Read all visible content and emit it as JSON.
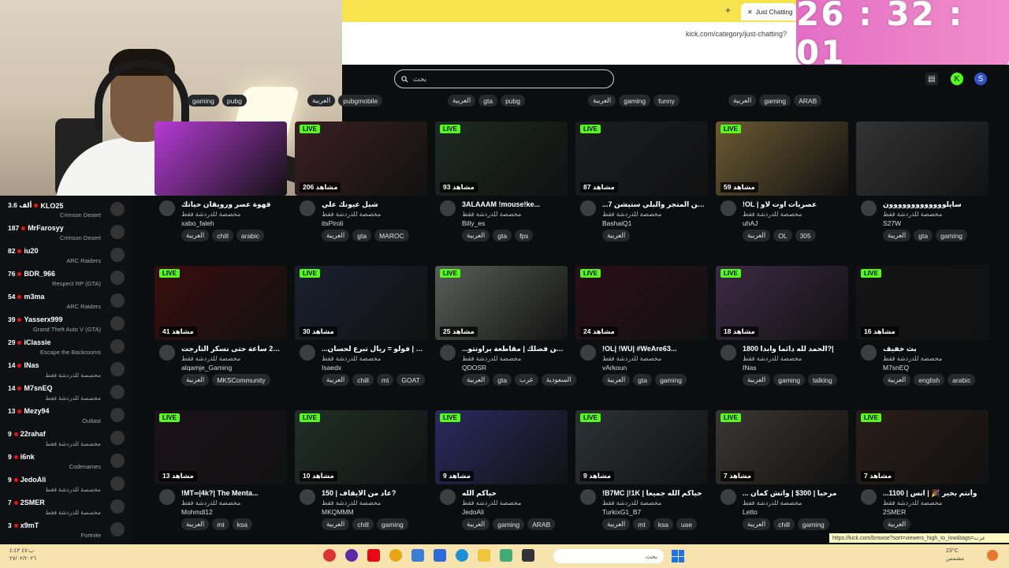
{
  "timer": "26 : 32 : 01",
  "browser": {
    "tab_label": "Just Chatting",
    "new_tab": "+",
    "tab_close": "✕",
    "url": "kick.com/category/just-chatting?",
    "status_url": "https://kick.com/browse?sort=viewers_high_to_low&tags=عرب"
  },
  "header": {
    "search_placeholder": "بحث"
  },
  "top_tag_rows": [
    [
      "gaming",
      "pubg"
    ],
    [
      "العربية",
      "pubgmobile"
    ],
    [
      "العربية",
      "gta",
      "pubg"
    ],
    [
      "العربية",
      "gaming",
      "funny"
    ],
    [
      "العربية",
      "gaming",
      "ARAB"
    ]
  ],
  "sidebar": [
    {
      "viewers": "3.6 ألف",
      "name": "KLO25",
      "category": "Crimson Desert"
    },
    {
      "viewers": "187",
      "name": "MrFarosyy",
      "category": "Crimson Desert"
    },
    {
      "viewers": "82",
      "name": "iu20",
      "category": "ARC Raiders"
    },
    {
      "viewers": "76",
      "name": "BDR_966",
      "category": "Respect RP (GTA)"
    },
    {
      "viewers": "54",
      "name": "m3ma",
      "category": "ARC Raiders"
    },
    {
      "viewers": "39",
      "name": "Yasserx999",
      "category": "Grand Theft Auto V (GTA)"
    },
    {
      "viewers": "29",
      "name": "iClassie",
      "category": "Escape the Backrooms"
    },
    {
      "viewers": "14",
      "name": "INas",
      "category": "مخصصة للدردشة فقط"
    },
    {
      "viewers": "14",
      "name": "M7snEQ",
      "category": "مخصصة للدردشة فقط"
    },
    {
      "viewers": "13",
      "name": "Mezy94",
      "category": "Outlast"
    },
    {
      "viewers": "9",
      "name": "22rahaf",
      "category": "مخصصة للدردشة فقط"
    },
    {
      "viewers": "9",
      "name": "i6nk",
      "category": "Codenames"
    },
    {
      "viewers": "9",
      "name": "JedoAli",
      "category": "مخصصة للدردشة فقط"
    },
    {
      "viewers": "7",
      "name": "2SMER",
      "category": "مخصصة للدردشة فقط"
    },
    {
      "viewers": "3",
      "name": "x9mT",
      "category": "Fortnite"
    }
  ],
  "streams": [
    {
      "live": "",
      "viewers": "",
      "title": "قهوة عصر ورويقان حياتك",
      "category": "مخصصة للدردشة فقط",
      "name": "xabo_faleh",
      "tags": [
        "العربية",
        "chill",
        "arabic"
      ],
      "color": "#b73bd6"
    },
    {
      "live": "LIVE",
      "viewers": "206 مشاهد",
      "title": "شيل عيونك علي",
      "category": "مخصصة للدردشة فقط",
      "name": "itsPiroli",
      "tags": [
        "العربية",
        "gta",
        "MAROC"
      ],
      "color": "#3a1f22"
    },
    {
      "live": "LIVE",
      "viewers": "93 مشاهد",
      "title": "3ALAAAM !mouse!ke...",
      "category": "مخصصة للدردشة فقط",
      "name": "Billy_es",
      "tags": [
        "العربية",
        "gta",
        "fps"
      ],
      "color": "#1c2a22"
    },
    {
      "live": "LIVE",
      "viewers": "87 مشاهد",
      "title": "...ن عن المتجر والبلي ستيشن 7",
      "category": "مخصصة للدردشة فقط",
      "name": "BashaiQ1",
      "tags": [
        "العربية"
      ],
      "color": "#1b1d22"
    },
    {
      "live": "LIVE",
      "viewers": "59 مشاهد",
      "title": "!OL | عصريات اوت لاو",
      "category": "مخصصة للدردشة فقط",
      "name": "uhAJ",
      "tags": [
        "العربية",
        "OL",
        "305"
      ],
      "color": "#6b5a32"
    },
    {
      "live": "",
      "viewers": "",
      "title": "سايلووووووووووووون",
      "category": "مخصصة للدردشة فقط",
      "name": "S27W",
      "tags": [
        "العربية",
        "gta",
        "gaming"
      ],
      "color": "#333"
    },
    {
      "live": "LIVE",
      "viewers": "41 مشاهد",
      "title": "بث 24 ساعة حتى نسكر التارجت",
      "category": "مخصصة للدردشة فقط",
      "name": "alqamje_Gaming",
      "tags": [
        "العربية",
        "MKSCommunity"
      ],
      "color": "#3a0d0d"
    },
    {
      "live": "LIVE",
      "viewers": "30 مشاهد",
      "title": "...نس | فولو = ريال تبرع لحسان",
      "category": "مخصصة للدردشة فقط",
      "name": "Isaedx",
      "tags": [
        "العربية",
        "chill",
        "mt",
        "GOAT"
      ],
      "color": "#1a2030"
    },
    {
      "live": "LIVE",
      "viewers": "25 مشاهد",
      "title": "...ويالله من فضلك | مقاطعة براونتو",
      "category": "مخصصة للدردشة فقط",
      "name": "QDOSR",
      "tags": [
        "العربية",
        "gta",
        "عرب",
        "السعودية"
      ],
      "color": "#5a5e58"
    },
    {
      "live": "LIVE",
      "viewers": "24 مشاهد",
      "title": "!OL| !WU| #WeAre63...",
      "category": "مخصصة للدردشة فقط",
      "name": "vArkoun",
      "tags": [
        "العربية",
        "gta",
        "gaming"
      ],
      "color": "#2a0e18"
    },
    {
      "live": "LIVE",
      "viewers": "18 مشاهد",
      "title": "الحمد لله دائما وابدا 1800?|",
      "category": "مخصصة للدردشة فقط",
      "name": "INas",
      "tags": [
        "العربية",
        "gaming",
        "talking"
      ],
      "color": "#3d2a45"
    },
    {
      "live": "LIVE",
      "viewers": "16 مشاهد",
      "title": "بث خفيف",
      "category": "مخصصة للدردشة فقط",
      "name": "M7snEQ",
      "tags": [
        "العربية",
        "english",
        "arabic"
      ],
      "color": "#141414"
    },
    {
      "live": "LIVE",
      "viewers": "13 مشاهد",
      "title": "!MT∞|4k?| The Menta...",
      "category": "مخصصة للدردشة فقط",
      "name": "Mohmdl12",
      "tags": [
        "العربية",
        "mt",
        "ksa"
      ],
      "color": "#1a1218"
    },
    {
      "live": "LIVE",
      "viewers": "10 مشاهد",
      "title": "عاد من الايقاف | 150?",
      "category": "مخصصة للدردشة فقط",
      "name": "MKQMMM",
      "tags": [
        "العربية",
        "chill",
        "gaming"
      ],
      "color": "#203028"
    },
    {
      "live": "LIVE",
      "viewers": "9 مشاهد",
      "title": "حياكم الله",
      "category": "مخصصة للدردشة فقط",
      "name": "JedoAli",
      "tags": [
        "العربية",
        "gaming",
        "ARAB"
      ],
      "color": "#2a2a60"
    },
    {
      "live": "LIVE",
      "viewers": "9 مشاهد",
      "title": "!B7MC |!1K | حياكم الله جميعا",
      "category": "مخصصة للدردشة فقط",
      "name": "TurkixG1_B7",
      "tags": [
        "العربية",
        "mt",
        "ksa",
        "uae"
      ],
      "color": "#2b3236"
    },
    {
      "live": "LIVE",
      "viewers": "7 مشاهد",
      "title": "... مرحبا | 300$ | واتش كمان",
      "category": "مخصصة للدردشة فقط",
      "name": "Letto",
      "tags": [
        "العربية",
        "chill",
        "gaming"
      ],
      "color": "#3a3634"
    },
    {
      "live": "LIVE",
      "viewers": "7 مشاهد",
      "title": "...وأنتم بخير 🎉 | انس | 1100",
      "category": "مخصصة للدردشة فقط",
      "name": "2SMER",
      "tags": [
        "العربية"
      ],
      "color": "#2a1e18"
    }
  ],
  "taskbar": {
    "search_text": "بحث",
    "left_text_1": "ب:٤٧ ٤:٤٣",
    "left_text_2": "٢٧/٠٢/٢٠٢٦",
    "right_text_1": "23°C",
    "right_text_2": "مشمس"
  }
}
